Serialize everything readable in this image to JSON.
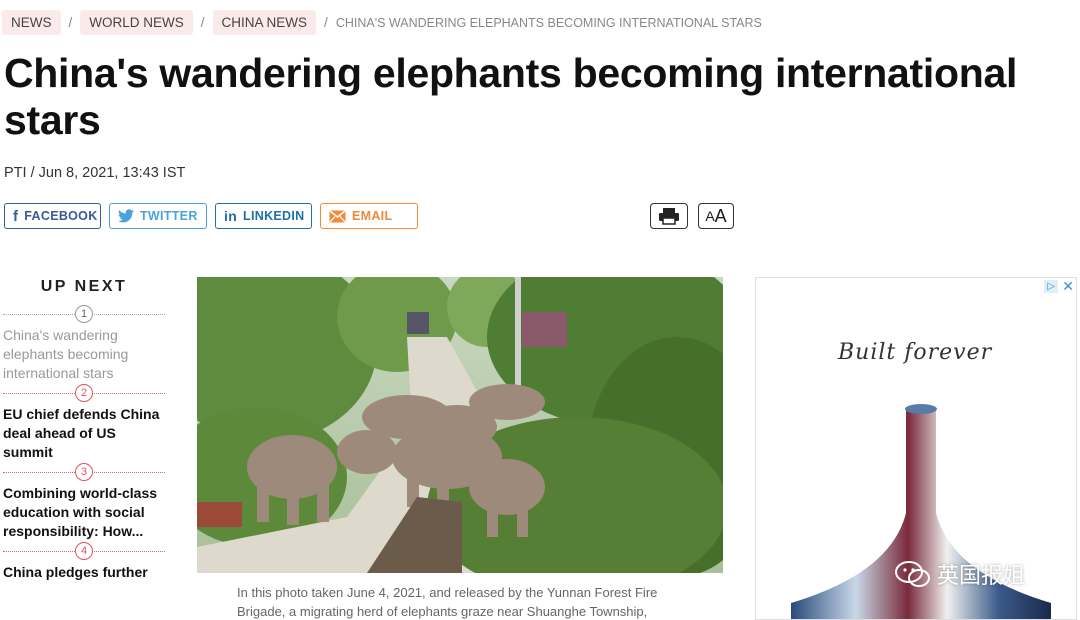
{
  "breadcrumb": {
    "items": [
      "NEWS",
      "WORLD NEWS",
      "CHINA NEWS"
    ],
    "current": "CHINA'S WANDERING ELEPHANTS BECOMING INTERNATIONAL STARS",
    "separator": "/"
  },
  "article": {
    "headline": "China's wandering elephants becoming international stars",
    "byline": "PTI / Jun 8, 2021, 13:43 IST",
    "caption": "In this photo taken June 4, 2021, and released by the Yunnan Forest Fire Brigade, a migrating herd of elephants graze near Shuanghe Township,"
  },
  "share": {
    "facebook": "FACEBOOK",
    "twitter": "TWITTER",
    "linkedin": "LINKEDIN",
    "email": "EMAIL"
  },
  "tools": {
    "font_small": "A",
    "font_big": "A"
  },
  "up_next": {
    "title": "UP NEXT",
    "items": [
      {
        "num": "1",
        "text": "China's wandering elephants becoming international stars"
      },
      {
        "num": "2",
        "text": "EU chief defends China deal ahead of US summit"
      },
      {
        "num": "3",
        "text": "Combining world-class education with social responsibility: How..."
      },
      {
        "num": "4",
        "text": "China pledges further"
      }
    ]
  },
  "ad": {
    "script_text": "Built forever",
    "choices_icon": "ad-choices-icon",
    "close_icon": "close-icon"
  },
  "watermark": {
    "text": "英国报姐",
    "icon": "wechat-icon"
  },
  "colors": {
    "facebook": "#3b5998",
    "twitter": "#4aa3df",
    "linkedin": "#1f6fa8",
    "email": "#f08a3a",
    "accent_red": "#e35656",
    "breadcrumb_bg": "#fbeaea"
  }
}
